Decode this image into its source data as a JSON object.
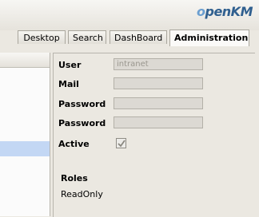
{
  "app": {
    "logo_text_1": "o",
    "logo_text_2": "penKM"
  },
  "tabs": [
    {
      "label": "Desktop",
      "active": false
    },
    {
      "label": "Search",
      "active": false
    },
    {
      "label": "DashBoard",
      "active": false
    },
    {
      "label": "Administration",
      "active": true
    }
  ],
  "form": {
    "user_label": "User",
    "user_value": "intranet",
    "mail_label": "Mail",
    "mail_value": "",
    "password_label": "Password",
    "password_value": "",
    "password_confirm_label": "Password",
    "password_confirm_value": "",
    "active_label": "Active",
    "active_checked": true
  },
  "roles": {
    "title": "Roles",
    "items": [
      "ReadOnly"
    ]
  },
  "colors": {
    "accent_logo": "#2f5f8f",
    "selected_row": "#c3d7f4",
    "background": "#ebe8e1"
  }
}
